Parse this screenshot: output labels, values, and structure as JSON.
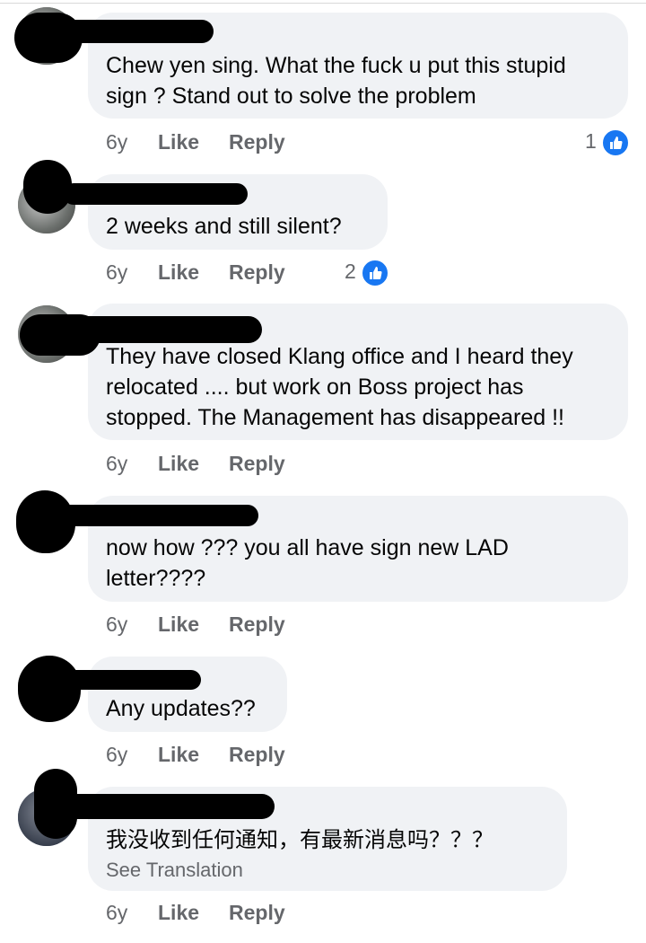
{
  "comments": [
    {
      "text": "Chew yen sing. What the fuck u put this stupid sign ? Stand out to solve the problem",
      "time": "6y",
      "like": "Like",
      "reply": "Reply",
      "reactions": "1"
    },
    {
      "text": "2 weeks and still silent?",
      "time": "6y",
      "like": "Like",
      "reply": "Reply",
      "reactions": "2"
    },
    {
      "text": "They have closed Klang office and I heard they relocated .... but work on Boss project has stopped. The Management has disappeared !!",
      "time": "6y",
      "like": "Like",
      "reply": "Reply"
    },
    {
      "text": "now how ??? you all have sign new LAD letter????",
      "time": "6y",
      "like": "Like",
      "reply": "Reply"
    },
    {
      "text": "Any updates??",
      "time": "6y",
      "like": "Like",
      "reply": "Reply"
    },
    {
      "text": "我没收到任何通知，有最新消息吗？？？",
      "see_translation": "See Translation",
      "time": "6y",
      "like": "Like",
      "reply": "Reply"
    }
  ],
  "colors": {
    "bubble": "#f0f2f5",
    "meta": "#65676b",
    "like_blue": "#1877f2",
    "redaction": "#000000"
  },
  "icons": [
    "thumbs-up-reaction-icon"
  ]
}
